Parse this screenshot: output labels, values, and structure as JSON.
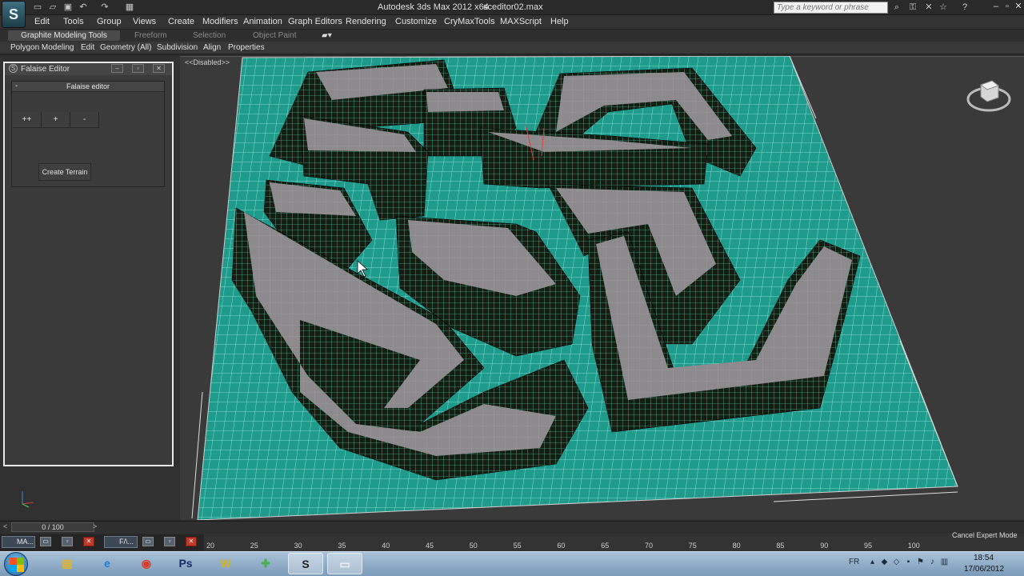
{
  "window": {
    "app_title": "Autodesk 3ds Max  2012 x64",
    "file_name": "sceditor02.max",
    "logo": "3ds-max-logo",
    "search_placeholder": "Type a keyword or phrase",
    "quick_access_icons": [
      "new-file-icon",
      "open-file-icon",
      "save-icon",
      "undo-icon",
      "redo-icon",
      "project-folder-icon"
    ],
    "info_icons": [
      "binoculars-icon",
      "subscription-icon",
      "communication-icon",
      "favorites-icon",
      "help-icon"
    ]
  },
  "menu": [
    "Edit",
    "Tools",
    "Group",
    "Views",
    "Create",
    "Modifiers",
    "Animation",
    "Graph Editors",
    "Rendering",
    "Customize",
    "CryMaxTools",
    "MAXScript",
    "Help"
  ],
  "ribbon": {
    "tabs": [
      "Graphite Modeling Tools",
      "Freeform",
      "Selection",
      "Object Paint"
    ],
    "panels": [
      "Polygon Modeling",
      "Edit",
      "Geometry (All)",
      "Subdivision",
      "Align",
      "Properties"
    ]
  },
  "falaise_editor": {
    "window_title": "Falaise Editor",
    "rollout_title": "Falaise editor",
    "rollout_toggle": "-",
    "buttons": [
      "++",
      "+",
      "-"
    ],
    "create_terrain_label": "Create Terrain"
  },
  "viewport": {
    "label": "<<Disabled>>",
    "grid_color": "#1f9b8c",
    "wire_color": "#6be8c8",
    "top_color": "#8c8a8c"
  },
  "timeline": {
    "frame_display": "0 / 100",
    "prev_arrow": "<",
    "next_arrow": ">",
    "ticks": [
      "20",
      "25",
      "30",
      "35",
      "40",
      "45",
      "50",
      "55",
      "60",
      "65",
      "70",
      "75",
      "80",
      "85",
      "90",
      "95",
      "100"
    ],
    "expert_button": "Cancel Expert Mode"
  },
  "mini_windows": [
    {
      "label": "MA..."
    },
    {
      "label": "F/\\..."
    }
  ],
  "taskbar": {
    "apps": [
      {
        "name": "explorer-icon",
        "glyph": "▤",
        "color": "#e6b422"
      },
      {
        "name": "internet-explorer-icon",
        "glyph": "e",
        "color": "#1f7fd6"
      },
      {
        "name": "chrome-icon",
        "glyph": "◉",
        "color": "#d93a2b"
      },
      {
        "name": "photoshop-icon",
        "glyph": "Ps",
        "color": "#1a2c6b"
      },
      {
        "name": "winamp-icon",
        "glyph": "W",
        "color": "#d8b21a"
      },
      {
        "name": "puzzle-app-icon",
        "glyph": "✚",
        "color": "#4caf50"
      },
      {
        "name": "3ds-max-taskbar-icon",
        "glyph": "S",
        "color": "#1e1e1e"
      },
      {
        "name": "window-app-icon",
        "glyph": "▭",
        "color": "#f0f0f0"
      }
    ],
    "language": "FR",
    "time": "18:54",
    "date": "17/06/2012"
  }
}
